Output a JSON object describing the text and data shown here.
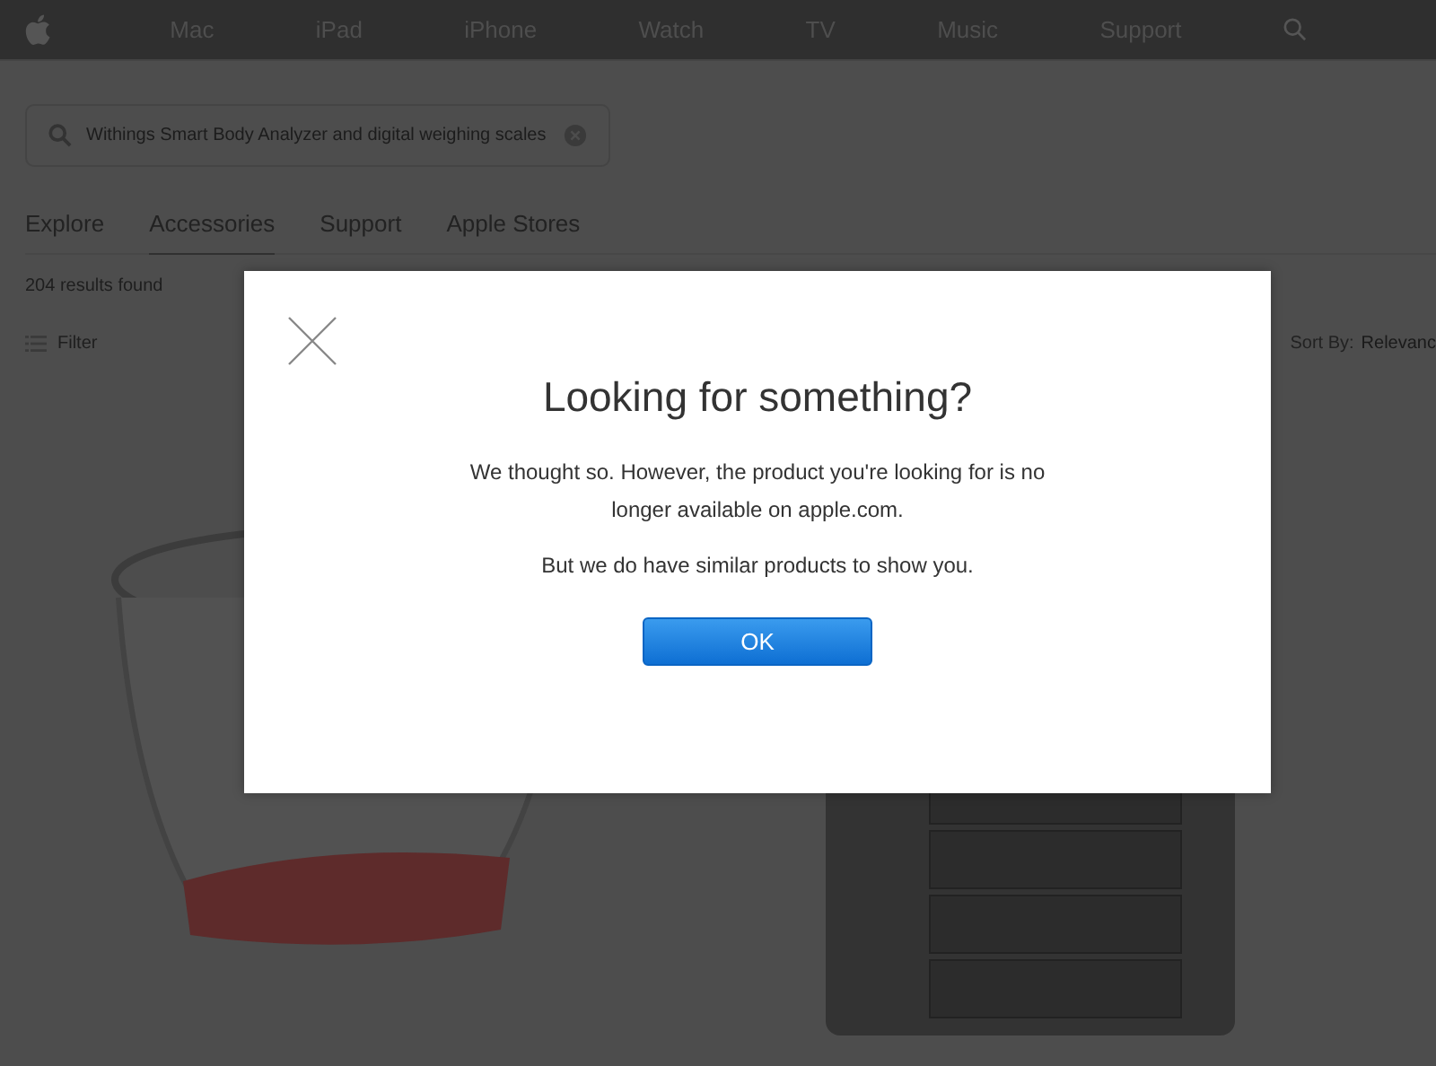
{
  "nav": {
    "items": [
      "Mac",
      "iPad",
      "iPhone",
      "Watch",
      "TV",
      "Music",
      "Support"
    ]
  },
  "search": {
    "value": "Withings Smart Body Analyzer and digital weighing scales"
  },
  "tabs": [
    {
      "label": "Explore",
      "selected": false
    },
    {
      "label": "Accessories",
      "selected": true
    },
    {
      "label": "Support",
      "selected": false
    },
    {
      "label": "Apple Stores",
      "selected": false
    }
  ],
  "results": {
    "count_text": "204 results found",
    "filter_label": "Filter",
    "sort_label": "Sort By:",
    "sort_value": "Relevanc"
  },
  "dialog": {
    "title": "Looking for something?",
    "paragraphs": [
      "We thought so. However, the product you're looking for is no longer available on apple.com.",
      "But we do have similar products to show you."
    ],
    "button": "OK"
  }
}
